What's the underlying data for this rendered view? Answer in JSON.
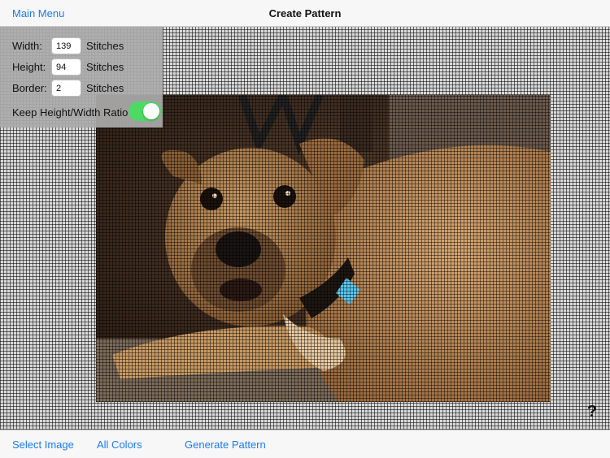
{
  "navbar": {
    "back_label": "Main Menu",
    "title": "Create Pattern"
  },
  "settings": {
    "width": {
      "label": "Width:",
      "value": "139",
      "unit": "Stitches"
    },
    "height": {
      "label": "Height:",
      "value": "94",
      "unit": "Stitches"
    },
    "border": {
      "label": "Border:",
      "value": "2",
      "unit": "Stitches"
    },
    "ratio_label": "Keep Height/Width Ratio",
    "ratio_on": true
  },
  "canvas": {
    "help_label": "?",
    "image_subject": "dog photo"
  },
  "toolbar": {
    "select_image": "Select Image",
    "all_colors": "All Colors",
    "generate": "Generate Pattern"
  },
  "colors": {
    "accent": "#1a7bf2",
    "toggle_on": "#4cd964"
  }
}
